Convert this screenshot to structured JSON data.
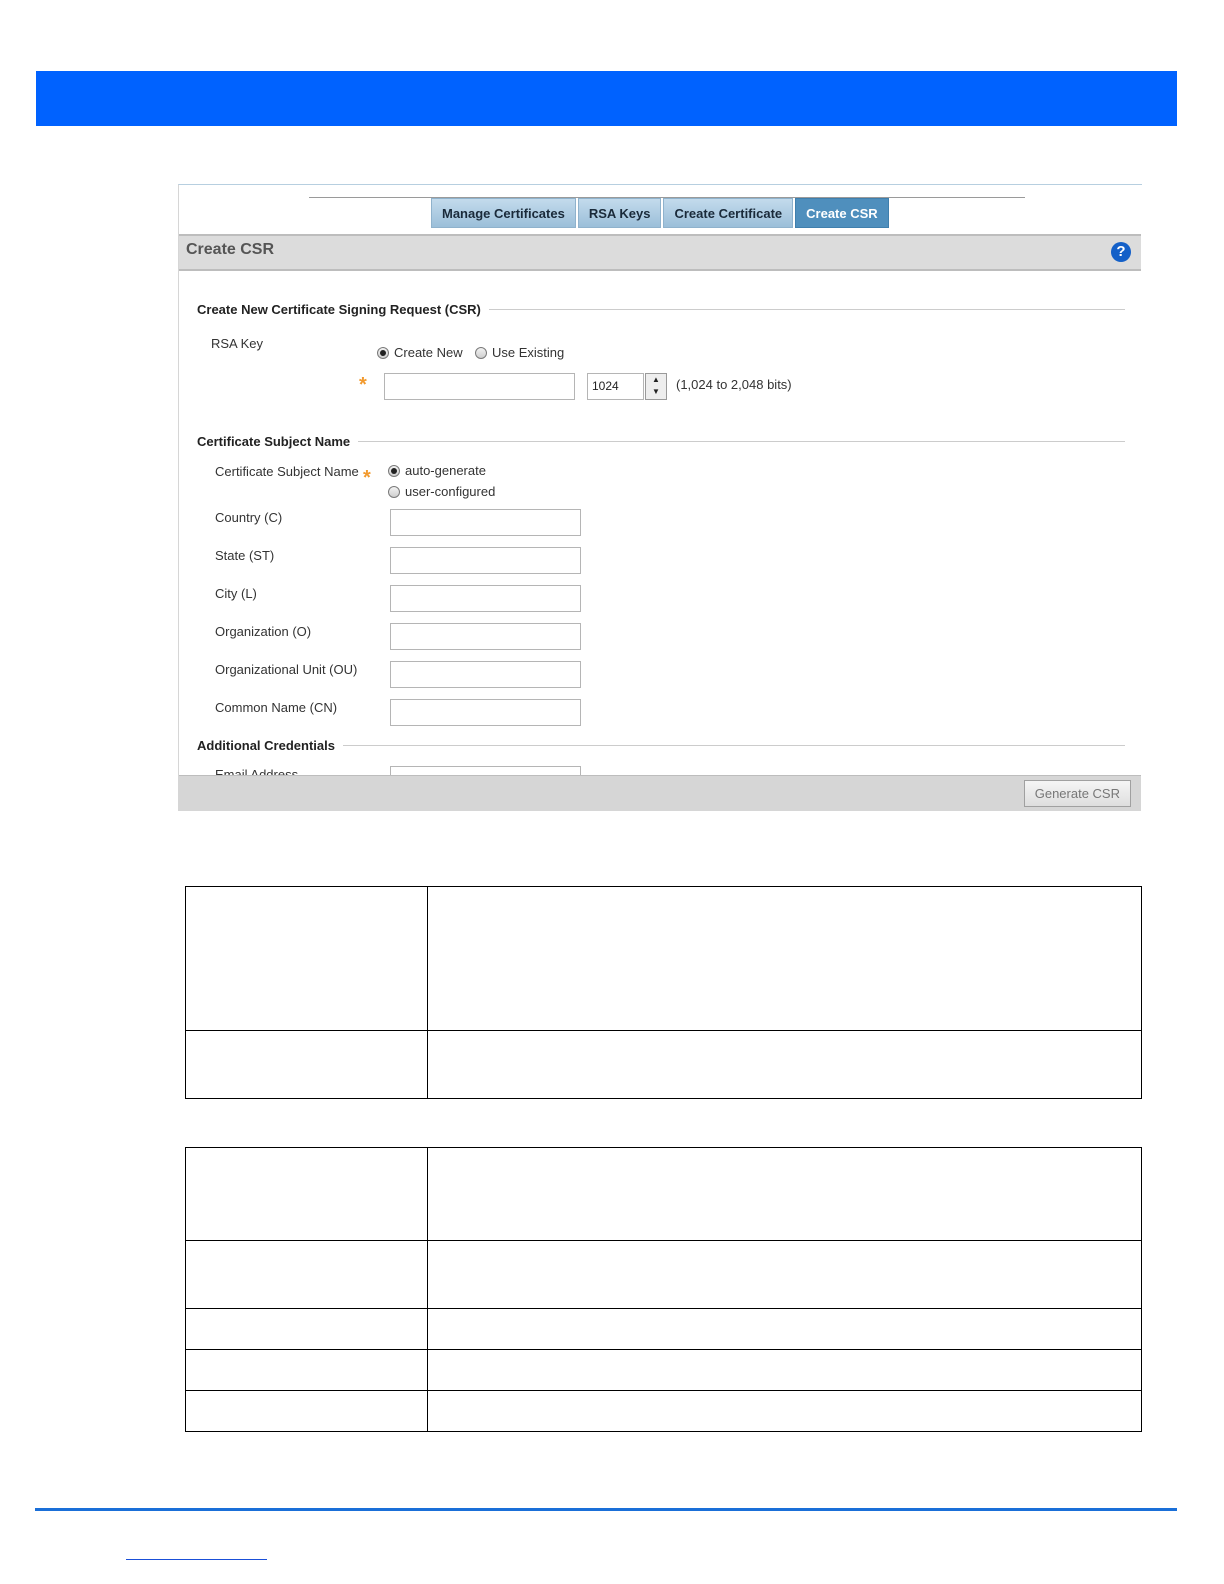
{
  "tabs": [
    {
      "label": "Manage Certificates"
    },
    {
      "label": "RSA Keys"
    },
    {
      "label": "Create Certificate"
    },
    {
      "label": "Create CSR",
      "active": true
    }
  ],
  "panel": {
    "title": "Create CSR",
    "help_icon": "help-icon"
  },
  "csr_section": {
    "title": "Create New Certificate Signing Request (CSR)",
    "rsa_key_label": "RSA Key",
    "radio_create_new": "Create New",
    "radio_use_existing": "Use Existing",
    "selected": "Create New",
    "key_name_value": "",
    "key_size_value": "1024",
    "key_size_hint": "(1,024 to 2,048 bits)"
  },
  "subject_section": {
    "title": "Certificate Subject Name",
    "subject_label": "Certificate Subject Name",
    "radio_auto": "auto-generate",
    "radio_user": "user-configured",
    "selected": "auto-generate",
    "fields": [
      {
        "label": "Country (C)",
        "value": ""
      },
      {
        "label": "State (ST)",
        "value": ""
      },
      {
        "label": "City (L)",
        "value": ""
      },
      {
        "label": "Organization (O)",
        "value": ""
      },
      {
        "label": "Organizational Unit (OU)",
        "value": ""
      },
      {
        "label": "Common Name (CN)",
        "value": ""
      }
    ]
  },
  "additional_section": {
    "title": "Additional Credentials",
    "email_label": "Email Address"
  },
  "footer": {
    "generate_button": "Generate CSR"
  },
  "colors": {
    "banner": "#0062ff",
    "active_tab": "#4f8fbd",
    "required_star": "#f29a2e",
    "rule": "#1a6fd8"
  }
}
